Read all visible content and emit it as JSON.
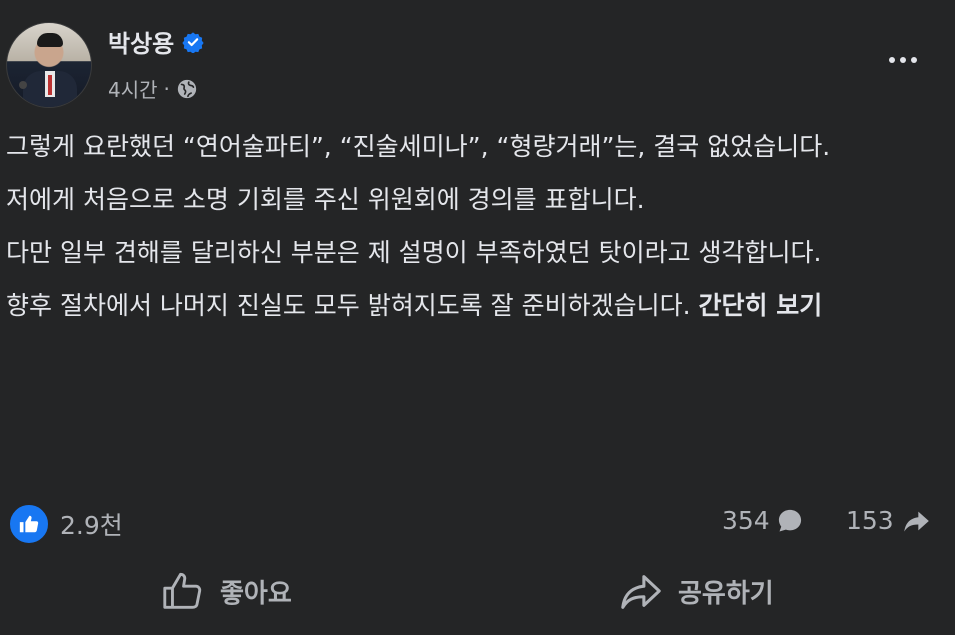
{
  "post": {
    "author": "박상용",
    "time": "4시간",
    "separator": "·",
    "body": [
      "그렇게 요란했던 “연어술파티”, “진술세미나”, “형량거래”는, 결국 없었습니다.",
      "저에게 처음으로 소명 기회를 주신 위원회에 경의를 표합니다.",
      "다만 일부 견해를 달리하신 부분은 제 설명이 부족하였던 탓이라고 생각합니다.",
      "향후 절차에서 나머지 진실도 모두 밝혀지도록 잘 준비하겠습니다."
    ],
    "see_more": "간단히 보기"
  },
  "stats": {
    "reactions": "2.9천",
    "comments": "354",
    "shares": "153"
  },
  "actions": {
    "like": "좋아요",
    "share": "공유하기"
  },
  "colors": {
    "background": "#242526",
    "text": "#e4e6eb",
    "secondary": "#b0b3b8",
    "accent": "#1877f2"
  }
}
